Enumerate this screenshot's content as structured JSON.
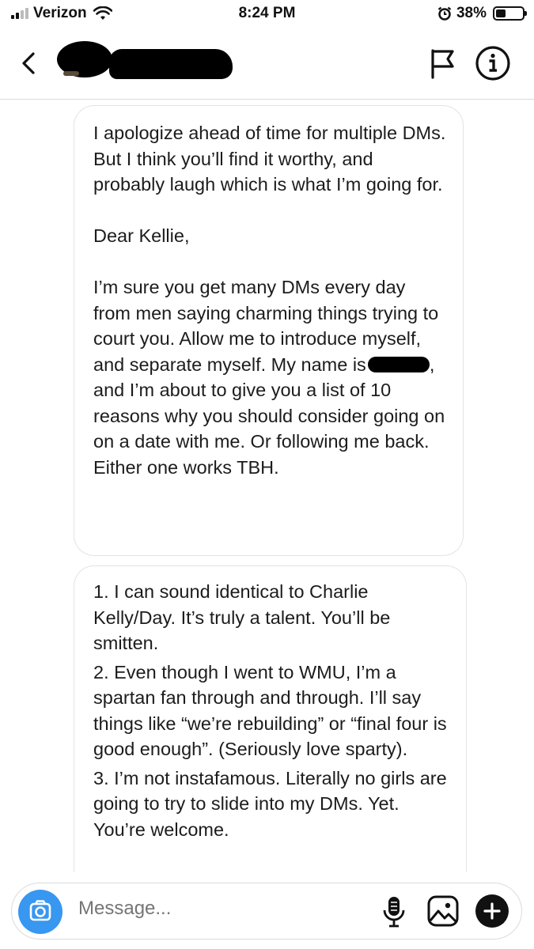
{
  "status_bar": {
    "carrier": "Verizon",
    "time": "8:24 PM",
    "battery_percent": "38%",
    "signal_bars_filled": 2,
    "signal_bars_total": 4,
    "battery_level": 0.38
  },
  "header": {
    "back_icon": "chevron-left-icon",
    "flag_icon": "flag-icon",
    "info_icon": "info-icon"
  },
  "messages": [
    {
      "paragraphs": [
        "I apologize ahead of time for multiple DMs. But I think you’ll find it worthy, and probably laugh which is what I’m going for.",
        "Dear Kellie,"
      ],
      "p3_before": "I’m sure you get many DMs every day from men saying charming things trying to court you. Allow me to introduce myself, and separate myself. My name is",
      "p3_after": ", and I’m about to give you a list of  10 reasons why you should consider going on on a date with me. Or following me back. Either one works TBH."
    },
    {
      "items": [
        "1. I can sound identical to Charlie Kelly/Day. It’s truly a talent. You’ll be smitten.",
        "2. Even though I went to WMU, I’m a spartan fan through and through. I’ll say things like “we’re rebuilding” or “final four is good enough”. (Seriously love sparty).",
        "3. I’m not instafamous. Literally no girls are going to try to slide into my DMs. Yet. You’re welcome."
      ]
    }
  ],
  "composer": {
    "placeholder": "Message...",
    "camera_icon": "camera-icon",
    "mic_icon": "microphone-icon",
    "gallery_icon": "image-icon",
    "plus_icon": "plus-icon",
    "accent_color": "#3897f0"
  }
}
